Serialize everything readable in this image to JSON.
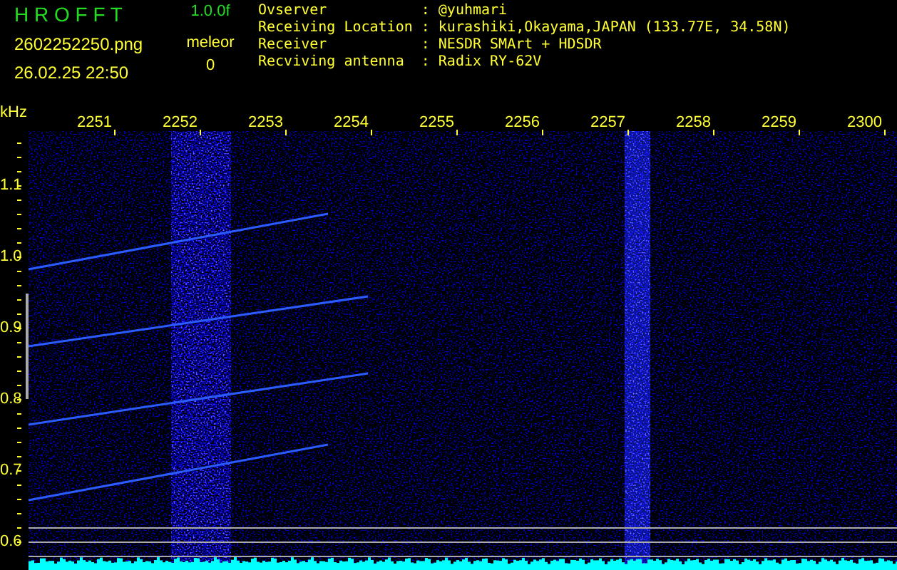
{
  "app": {
    "title": "H R O F F T",
    "version": "1.0.0f",
    "filename": "2602252250.png",
    "datetime": "26.02.25 22:50",
    "meteor_label": "meleor",
    "meteor_count": "0"
  },
  "info": [
    {
      "label": "Ovserver",
      "separator": ":",
      "value": "@yuhmari"
    },
    {
      "label": "Receiving Location",
      "separator": ":",
      "value": "kurashiki,Okayama,JAPAN (133.77E, 34.58N)"
    },
    {
      "label": "Receiver",
      "separator": ":",
      "value": "NESDR SMArt + HDSDR"
    },
    {
      "label": "Recviving antenna",
      "separator": ":",
      "value": "Radix RY-62V"
    }
  ],
  "spectrogram": {
    "unit": "kHz",
    "x_labels": [
      "2251",
      "2252",
      "2253",
      "2254",
      "2255",
      "2256",
      "2257",
      "2258",
      "2259",
      "2300"
    ],
    "y_labels": [
      "1.1",
      "1.0",
      "0.9",
      "0.8",
      "0.7",
      "0.6"
    ]
  }
}
